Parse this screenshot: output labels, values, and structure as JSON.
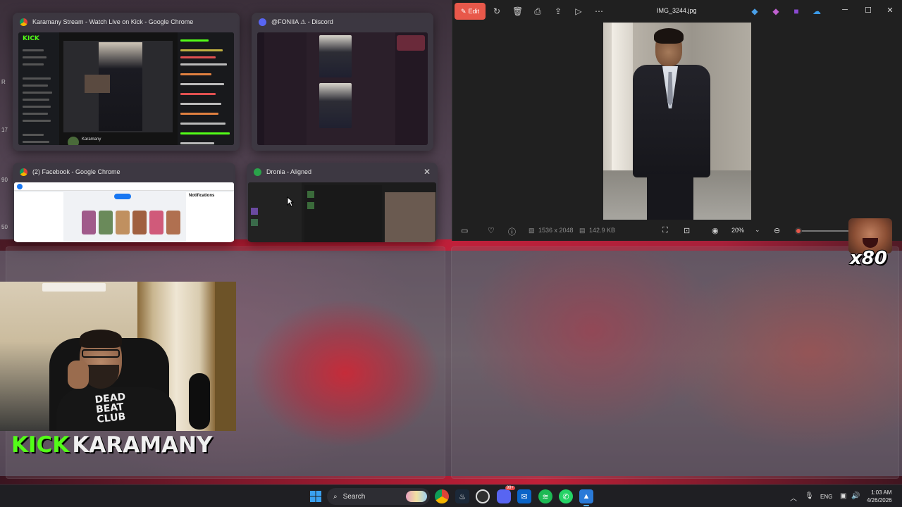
{
  "task_view": {
    "kick_window": {
      "title": "Karamany Stream - Watch Live on Kick - Google Chrome",
      "logo": "KICK",
      "streamer": "Karamany"
    },
    "discord_window": {
      "title": "@FONIIA ⚠ - Discord"
    },
    "facebook_window": {
      "title": "(2) Facebook - Google Chrome",
      "notif_header": "Notifications"
    },
    "dronia_window": {
      "title": "Dronia - Aligned",
      "close": "✕"
    }
  },
  "photos_app": {
    "edit_label": "Edit",
    "filename": "IMG_3244.jpg",
    "dimensions": "1536 x 2048",
    "filesize": "142.9 KB",
    "zoom": "20%",
    "zoom_level": 0.05,
    "colors": {
      "accent": "#e8584a",
      "background": "#202020"
    }
  },
  "overlay": {
    "emote_count": "x80",
    "stream_name_kick": "KICK",
    "stream_name_user": "KARAMANY",
    "shirt_text": "DEAD BEAT CLUB",
    "side_numbers": [
      "R",
      "17",
      "90",
      "50"
    ]
  },
  "taskbar": {
    "search_label": "Search",
    "language": "ENG",
    "time": "1:03 AM",
    "date": "4/26/2026",
    "discord_badge": "99+",
    "apps": [
      "windows-start",
      "search",
      "paint",
      "chrome",
      "steam",
      "obs",
      "discord",
      "outlook",
      "spotify",
      "whatsapp",
      "photos"
    ]
  }
}
